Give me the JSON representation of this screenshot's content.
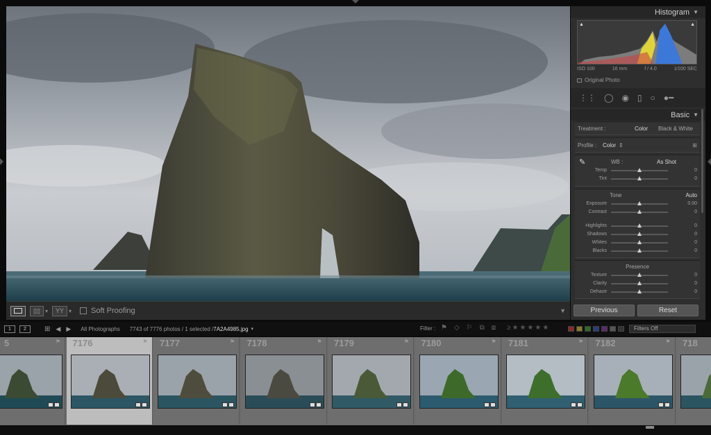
{
  "histogram": {
    "title": "Histogram",
    "iso": "ISO 100",
    "focal": "16 mm",
    "aperture": "f / 4.0",
    "shutter": "1⁄100 SEC",
    "original_label": "Original Photo"
  },
  "basic": {
    "title": "Basic",
    "treatment_label": "Treatment :",
    "treatment_color": "Color",
    "treatment_bw": "Black & White",
    "profile_label": "Profile :",
    "profile_value": "Color",
    "wb_label": "WB :",
    "wb_value": "As Shot",
    "sliders_wb": [
      {
        "label": "Temp",
        "value": "0",
        "pos": 0.5
      },
      {
        "label": "Tint",
        "value": "0",
        "pos": 0.5
      }
    ],
    "tone_label": "Tone",
    "auto_label": "Auto",
    "sliders_tone1": [
      {
        "label": "Exposure",
        "value": "0.00",
        "pos": 0.5
      },
      {
        "label": "Contrast",
        "value": "0",
        "pos": 0.5
      }
    ],
    "sliders_tone2": [
      {
        "label": "Highlights",
        "value": "0",
        "pos": 0.5
      },
      {
        "label": "Shadows",
        "value": "0",
        "pos": 0.5
      },
      {
        "label": "Whites",
        "value": "0",
        "pos": 0.5
      },
      {
        "label": "Blacks",
        "value": "0",
        "pos": 0.5
      }
    ],
    "presence_label": "Presence",
    "sliders_presence": [
      {
        "label": "Texture",
        "value": "0",
        "pos": 0.5
      },
      {
        "label": "Clarity",
        "value": "0",
        "pos": 0.5
      },
      {
        "label": "Dehaze",
        "value": "0",
        "pos": 0.5
      }
    ]
  },
  "buttons": {
    "previous": "Previous",
    "reset": "Reset"
  },
  "toolbar": {
    "soft_proofing": "Soft Proofing"
  },
  "filmstrip_header": {
    "page1": "1",
    "page2": "2",
    "source": "All Photographs",
    "count": "7743 of 7776 photos / 1 selected /",
    "file": "7A2A4985.jpg",
    "filter_label": "Filter :",
    "filters_off": "Filters Off"
  },
  "filmstrip": {
    "cells": [
      {
        "num": "5",
        "selected": false
      },
      {
        "num": "7176",
        "selected": true
      },
      {
        "num": "7177",
        "selected": false
      },
      {
        "num": "7178",
        "selected": false
      },
      {
        "num": "7179",
        "selected": false
      },
      {
        "num": "7180",
        "selected": false
      },
      {
        "num": "7181",
        "selected": false
      },
      {
        "num": "7182",
        "selected": false
      },
      {
        "num": "718",
        "selected": false
      }
    ]
  },
  "colors": {
    "label_colors": [
      "#8a2a2a",
      "#8a7a2a",
      "#2a6a2a",
      "#2a3a7a",
      "#5a2a6a",
      "#555555",
      "#333333"
    ]
  }
}
